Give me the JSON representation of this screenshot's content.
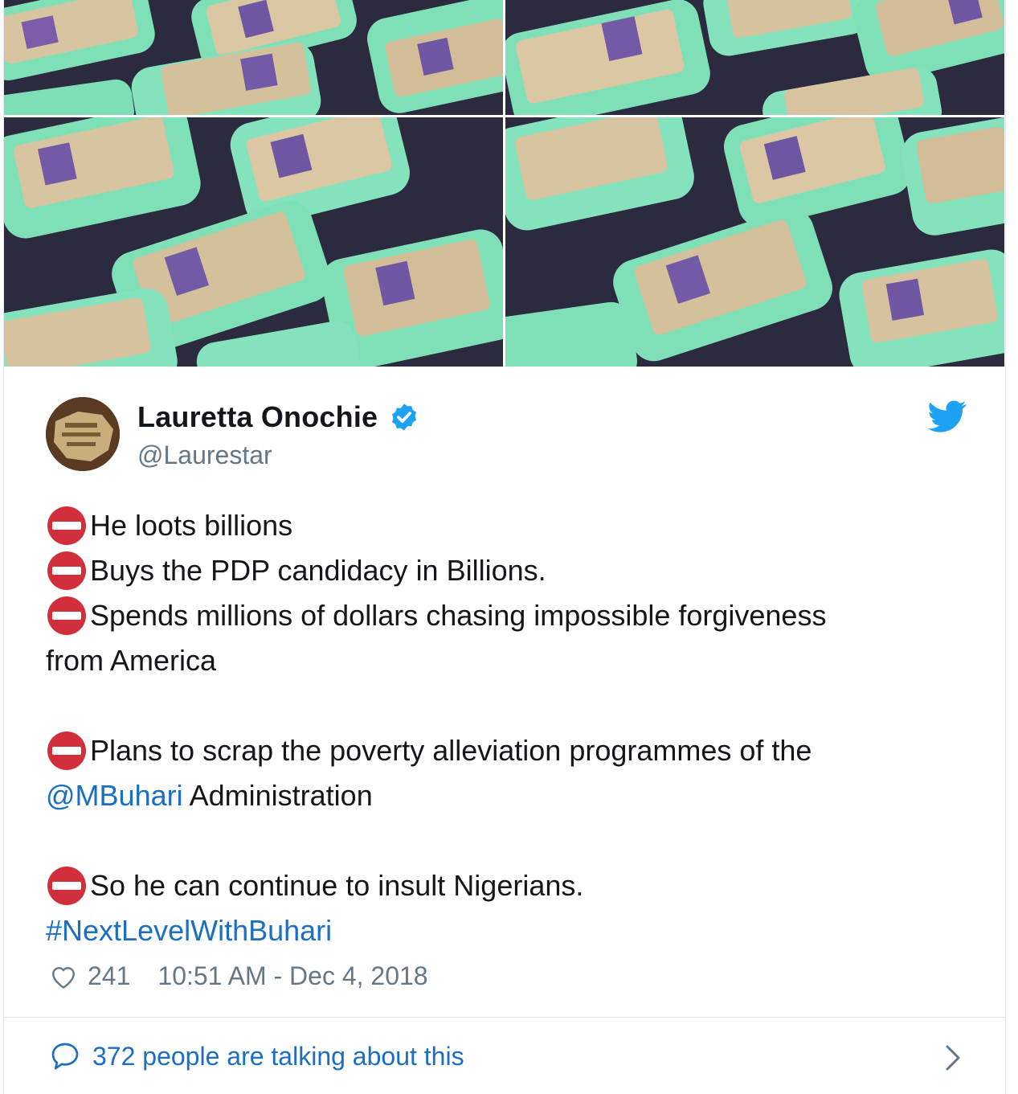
{
  "author": {
    "display_name": "Lauretta Onochie",
    "handle": "@Laurestar"
  },
  "tweet": {
    "lines": [
      {
        "text": "He loots billions"
      },
      {
        "text": "Buys the PDP candidacy in Billions."
      },
      {
        "text": "Spends millions of dollars chasing impossible forgiveness"
      },
      {
        "text": "from America"
      },
      {
        "text": "Plans to scrap the poverty alleviation programmes of the"
      },
      {
        "mention": "@MBuhari",
        "text": " Administration"
      },
      {
        "text": "So he can continue to insult Nigerians."
      },
      {
        "hashtag": "#NextLevelWithBuhari"
      }
    ]
  },
  "footer": {
    "likes": "241",
    "timestamp": "10:51 AM - Dec 4, 2018",
    "talking": "372 people are talking about this"
  },
  "icons": {
    "verified": "verified-badge-icon",
    "twitter": "twitter-bird-icon",
    "no_entry": "no-entry-emoji",
    "like": "heart-icon",
    "reply": "speech-bubble-icon",
    "more": "chevron-right-icon"
  },
  "colors": {
    "link": "#1b6ec2",
    "verified": "#1da1f2",
    "twitter": "#1da1f2",
    "no_entry_red": "#d22f3c",
    "secondary_text": "#657786",
    "container_green": "#7fe0b7"
  }
}
